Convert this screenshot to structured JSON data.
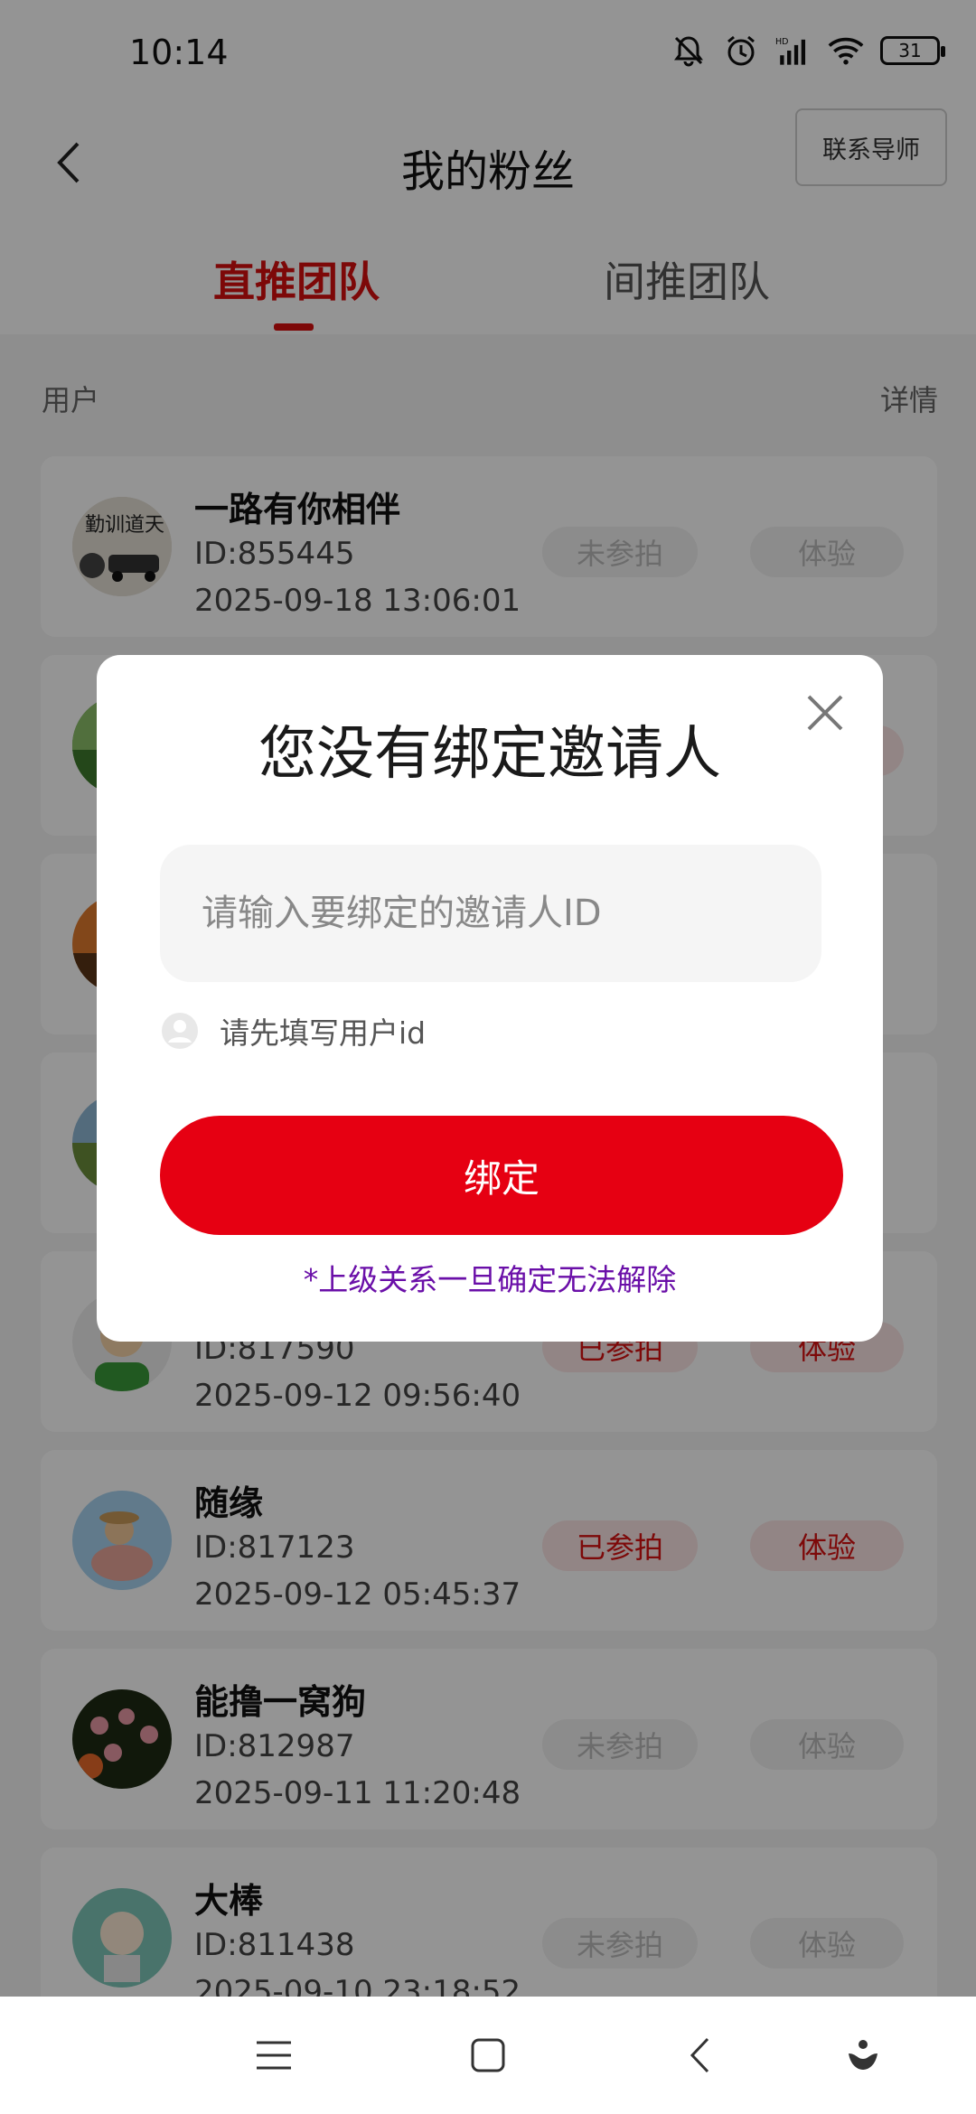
{
  "status_bar": {
    "time": "10:14",
    "battery": "31",
    "icons": [
      "bell-muted-icon",
      "alarm-icon",
      "hd-signal-icon",
      "wifi-icon",
      "battery-icon"
    ]
  },
  "header": {
    "title": "我的粉丝",
    "contact_label": "联系导师",
    "back_icon": "chevron-left-icon"
  },
  "tabs": [
    {
      "label": "直推团队",
      "active": true
    },
    {
      "label": "间推团队",
      "active": false
    }
  ],
  "list_header": {
    "left": "用户",
    "right": "详情"
  },
  "rows": [
    {
      "name": "一路有你相伴",
      "id": "ID:855445",
      "time": "2025-09-18 13:06:01",
      "join": "未参拍",
      "exp": "体验",
      "state": "off"
    },
    {
      "name": "",
      "id": "",
      "time": "",
      "join": "",
      "exp": "",
      "state": "on"
    },
    {
      "name": "",
      "id": "",
      "time": "",
      "join": "",
      "exp": "",
      "state": "off"
    },
    {
      "name": "",
      "id": "",
      "time": "",
      "join": "",
      "exp": "",
      "state": "off"
    },
    {
      "name": "",
      "id": "ID:817590",
      "time": "2025-09-12 09:56:40",
      "join": "已参拍",
      "exp": "体验",
      "state": "on"
    },
    {
      "name": "随缘",
      "id": "ID:817123",
      "time": "2025-09-12 05:45:37",
      "join": "已参拍",
      "exp": "体验",
      "state": "on"
    },
    {
      "name": "能撸一窝狗",
      "id": "ID:812987",
      "time": "2025-09-11 11:20:48",
      "join": "未参拍",
      "exp": "体验",
      "state": "off"
    },
    {
      "name": "大棒",
      "id": "ID:811438",
      "time": "2025-09-10 23:18:52",
      "join": "未参拍",
      "exp": "体验",
      "state": "off"
    }
  ],
  "modal": {
    "title": "您没有绑定邀请人",
    "input_placeholder": "请输入要绑定的邀请人ID",
    "input_value": "",
    "hint": "请先填写用户id",
    "bind_label": "绑定",
    "warning": "*上级关系一旦确定无法解除"
  },
  "colors": {
    "accent": "#e60012",
    "tab_active": "#d80f0f",
    "warning": "#6a0fa8"
  },
  "nav": [
    "menu-icon",
    "home-square-icon",
    "back-icon",
    "assistant-icon"
  ]
}
